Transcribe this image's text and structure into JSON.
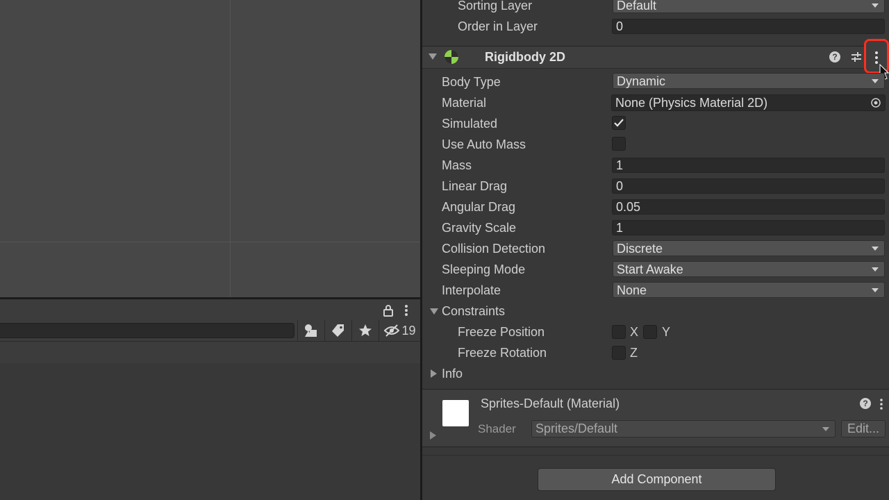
{
  "project_toolbar": {
    "hidden_count": "19",
    "icons": [
      "lock-icon",
      "kebab-menu-icon",
      "type-filter-icon",
      "label-filter-icon",
      "favorite-star-icon",
      "hidden-visibility-icon"
    ]
  },
  "renderer_fields": {
    "sorting_layer_label": "Sorting Layer",
    "sorting_layer_value": "Default",
    "order_in_layer_label": "Order in Layer",
    "order_in_layer_value": "0"
  },
  "rigidbody": {
    "title": "Rigidbody 2D",
    "fields": {
      "body_type": {
        "label": "Body Type",
        "value": "Dynamic"
      },
      "material": {
        "label": "Material",
        "value": "None (Physics Material 2D)"
      },
      "simulated": {
        "label": "Simulated",
        "checked": true
      },
      "use_auto_mass": {
        "label": "Use Auto Mass",
        "checked": false
      },
      "mass": {
        "label": "Mass",
        "value": "1"
      },
      "linear_drag": {
        "label": "Linear Drag",
        "value": "0"
      },
      "angular_drag": {
        "label": "Angular Drag",
        "value": "0.05"
      },
      "gravity_scale": {
        "label": "Gravity Scale",
        "value": "1"
      },
      "collision_detection": {
        "label": "Collision Detection",
        "value": "Discrete"
      },
      "sleeping_mode": {
        "label": "Sleeping Mode",
        "value": "Start Awake"
      },
      "interpolate": {
        "label": "Interpolate",
        "value": "None"
      }
    },
    "constraints": {
      "label": "Constraints",
      "freeze_position_label": "Freeze Position",
      "freeze_rotation_label": "Freeze Rotation",
      "x_label": "X",
      "y_label": "Y",
      "z_label": "Z"
    },
    "info_label": "Info"
  },
  "material_section": {
    "name": "Sprites-Default (Material)",
    "shader_label": "Shader",
    "shader_value": "Sprites/Default",
    "edit_label": "Edit..."
  },
  "add_component_label": "Add Component",
  "colors": {
    "highlight": "#ff2d1f",
    "rigidbody_icon_green": "#8fd14f"
  }
}
